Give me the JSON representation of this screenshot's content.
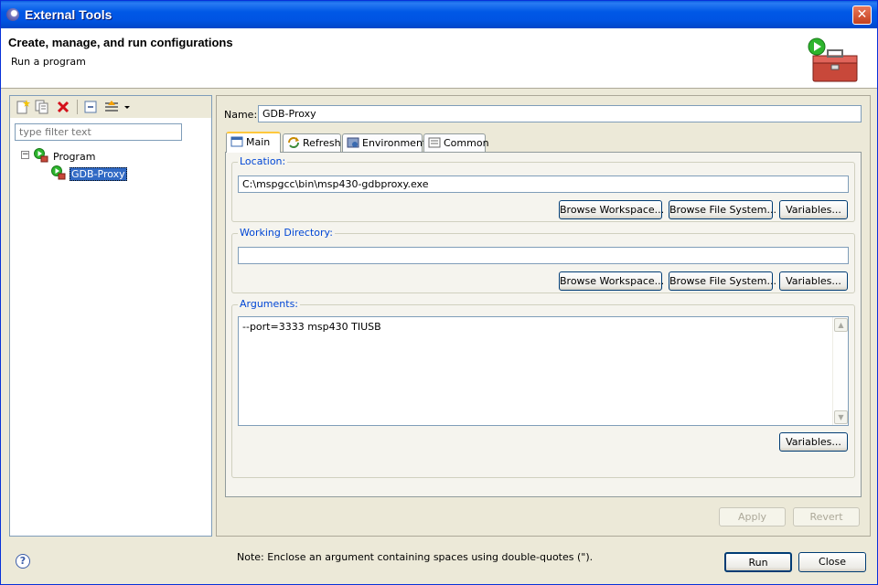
{
  "window": {
    "title": "External Tools"
  },
  "header": {
    "title": "Create, manage, and run configurations",
    "subtitle": "Run a program"
  },
  "left": {
    "filter_placeholder": "type filter text",
    "tree": {
      "root": {
        "label": "Program",
        "expander": "−"
      },
      "child": {
        "label": "GDB-Proxy"
      }
    }
  },
  "right": {
    "name_label": "Name:",
    "name_value": "GDB-Proxy",
    "tabs": [
      {
        "label": "Main",
        "icon": "main-tab-icon"
      },
      {
        "label": "Refresh",
        "icon": "refresh-icon"
      },
      {
        "label": "Environment",
        "icon": "environment-icon"
      },
      {
        "label": "Common",
        "icon": "common-icon"
      }
    ],
    "location": {
      "legend": "Location:",
      "value": "C:\\mspgcc\\bin\\msp430-gdbproxy.exe",
      "browse_workspace": "Browse Workspace...",
      "browse_filesystem": "Browse File System...",
      "variables": "Variables..."
    },
    "working_directory": {
      "legend": "Working Directory:",
      "value": "",
      "browse_workspace": "Browse Workspace...",
      "browse_filesystem": "Browse File System...",
      "variables": "Variables..."
    },
    "arguments": {
      "legend": "Arguments:",
      "value": "--port=3333 msp430 TIUSB",
      "variables": "Variables...",
      "note": "Note: Enclose an argument containing spaces using double-quotes (\")."
    },
    "apply": "Apply",
    "revert": "Revert"
  },
  "footer": {
    "help_icon": "?",
    "run": "Run",
    "close": "Close"
  },
  "colors": {
    "title_bar": "#0054e3",
    "group_legend": "#0046d5",
    "selection": "#316ac5"
  }
}
